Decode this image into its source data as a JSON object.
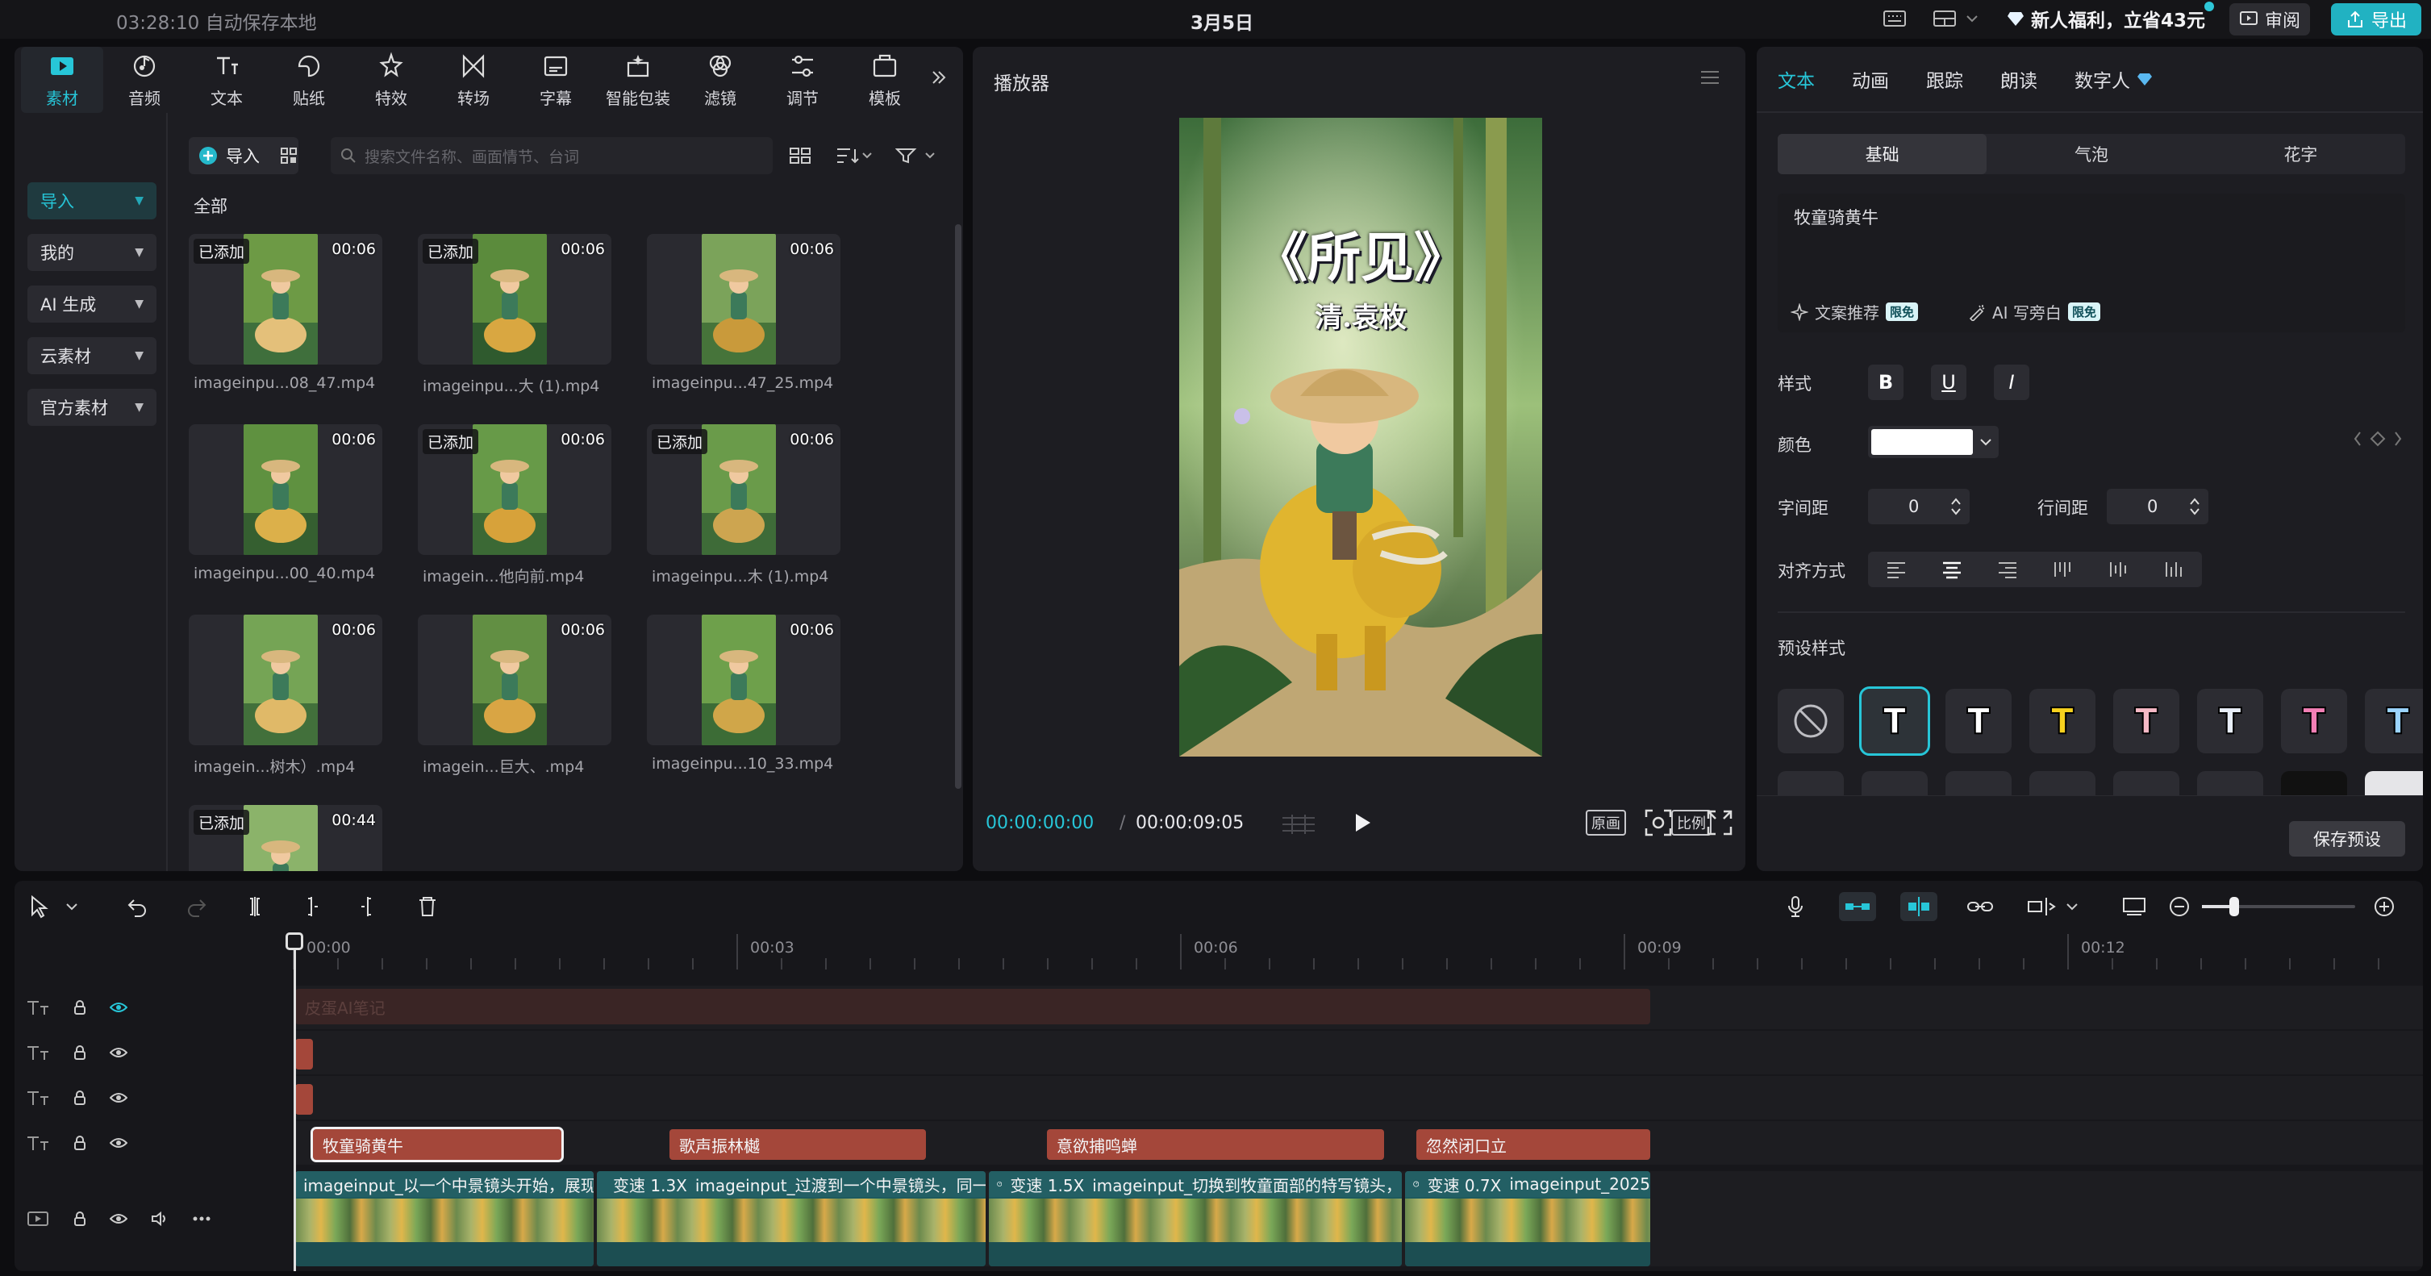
{
  "topbar": {
    "autosave": "03:28:10 自动保存本地",
    "title": "3月5日",
    "promo": "新人福利，立省43元",
    "review": "审阅",
    "export": "导出"
  },
  "tool_tabs": [
    {
      "label": "素材",
      "icon": "media-icon"
    },
    {
      "label": "音频",
      "icon": "audio-icon"
    },
    {
      "label": "文本",
      "icon": "text-icon"
    },
    {
      "label": "贴纸",
      "icon": "sticker-icon"
    },
    {
      "label": "特效",
      "icon": "effects-icon"
    },
    {
      "label": "转场",
      "icon": "transition-icon"
    },
    {
      "label": "字幕",
      "icon": "subtitle-icon"
    },
    {
      "label": "智能包装",
      "icon": "smart-pack-icon"
    },
    {
      "label": "滤镜",
      "icon": "filter-icon"
    },
    {
      "label": "调节",
      "icon": "adjust-icon"
    },
    {
      "label": "模板",
      "icon": "template-icon"
    }
  ],
  "media_sidebar": [
    "导入",
    "我的",
    "AI 生成",
    "云素材",
    "官方素材"
  ],
  "media": {
    "import_label": "导入",
    "search_placeholder": "搜索文件名称、画面情节、台词",
    "all_label": "全部",
    "added_badge": "已添加",
    "clips": [
      {
        "name": "imageinpu...08_47.mp4",
        "duration": "00:06",
        "added": true
      },
      {
        "name": "imageinpu...大 (1).mp4",
        "duration": "00:06",
        "added": true
      },
      {
        "name": "imageinpu...47_25.mp4",
        "duration": "00:06",
        "added": false
      },
      {
        "name": "imageinpu...00_40.mp4",
        "duration": "00:06",
        "added": false
      },
      {
        "name": "imagein...他向前.mp4",
        "duration": "00:06",
        "added": true
      },
      {
        "name": "imageinpu...木 (1).mp4",
        "duration": "00:06",
        "added": true
      },
      {
        "name": "imagein...树木）.mp4",
        "duration": "00:06",
        "added": false
      },
      {
        "name": "imagein...巨大、.mp4",
        "duration": "00:06",
        "added": false
      },
      {
        "name": "imageinpu...10_33.mp4",
        "duration": "00:06",
        "added": false
      },
      {
        "name": "",
        "duration": "00:44",
        "added": true
      }
    ]
  },
  "player": {
    "title": "播放器",
    "poem_title": "《所见》",
    "poem_author": "清.袁枚",
    "time_current": "00:00:00:00",
    "time_separator": "/",
    "time_total": "00:00:09:05",
    "btn_original": "原画",
    "btn_ratio": "比例"
  },
  "props": {
    "tabs": [
      "文本",
      "动画",
      "跟踪",
      "朗读",
      "数字人"
    ],
    "sub_tabs": [
      "基础",
      "气泡",
      "花字"
    ],
    "text_value": "牧童骑黄牛",
    "copy_suggest": "文案推荐",
    "ai_voiceover": "AI 写旁白",
    "free_badge": "限免",
    "style_label": "样式",
    "bold": "B",
    "underline": "U",
    "italic": "I",
    "color_label": "颜色",
    "color_value": "#ffffff",
    "letter_spacing_label": "字间距",
    "letter_spacing_value": "0",
    "line_spacing_label": "行间距",
    "line_spacing_value": "0",
    "align_label": "对齐方式",
    "preset_label": "预设样式",
    "presets": [
      {
        "glyph": "",
        "color": "#bdbdc2"
      },
      {
        "glyph": "T",
        "color": "#ffffff"
      },
      {
        "glyph": "T",
        "color": "#ffffff"
      },
      {
        "glyph": "T",
        "color": "#f7d11e"
      },
      {
        "glyph": "T",
        "color": "#f6b9c6"
      },
      {
        "glyph": "T",
        "color": "#e8eef8"
      },
      {
        "glyph": "T",
        "color": "#f37fb5"
      },
      {
        "glyph": "T",
        "color": "#9bd4ff"
      }
    ],
    "save_preset": "保存预设"
  },
  "timeline": {
    "ruler": [
      "00:00",
      "00:03",
      "00:06",
      "00:09",
      "00:12"
    ],
    "faint_track_label": "皮蛋AI笔记",
    "captions": [
      {
        "text": "牧童骑黄牛"
      },
      {
        "text": "歌声振林樾"
      },
      {
        "text": "意欲捕鸣蝉"
      },
      {
        "text": "忽然闭口立"
      }
    ],
    "video_clips": [
      {
        "label": "imageinput_以一个中景镜头开始，展现一",
        "speed": ""
      },
      {
        "label": "imageinput_过渡到一个中景镜头，同一",
        "speed": "变速 1.3X"
      },
      {
        "label": "imageinput_切换到牧童面部的特写镜头，",
        "speed": "变速 1.5X"
      },
      {
        "label": "imageinput_2025",
        "speed": "变速 0.7X"
      }
    ]
  }
}
